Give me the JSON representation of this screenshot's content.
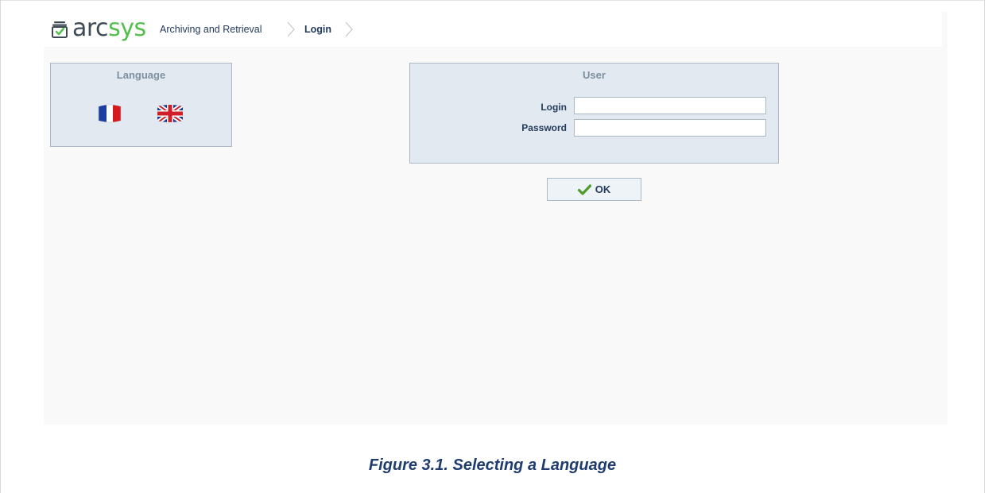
{
  "header": {
    "logo_prefix": "arc",
    "logo_suffix": "sys",
    "breadcrumb": [
      "Archiving and Retrieval",
      "Login"
    ]
  },
  "language_panel": {
    "title": "Language",
    "flags": [
      "french-flag-icon",
      "english-flag-icon"
    ]
  },
  "user_panel": {
    "title": "User",
    "login_label": "Login",
    "login_value": "",
    "password_label": "Password",
    "password_value": ""
  },
  "ok_button": {
    "label": "OK",
    "icon": "checkmark-icon"
  },
  "caption": "Figure 3.1. Selecting a Language",
  "colors": {
    "panel_bg": "#e2e9f0",
    "panel_border": "#a9b9c8",
    "brand_green": "#53c04c",
    "text_navy": "#233b5c"
  }
}
